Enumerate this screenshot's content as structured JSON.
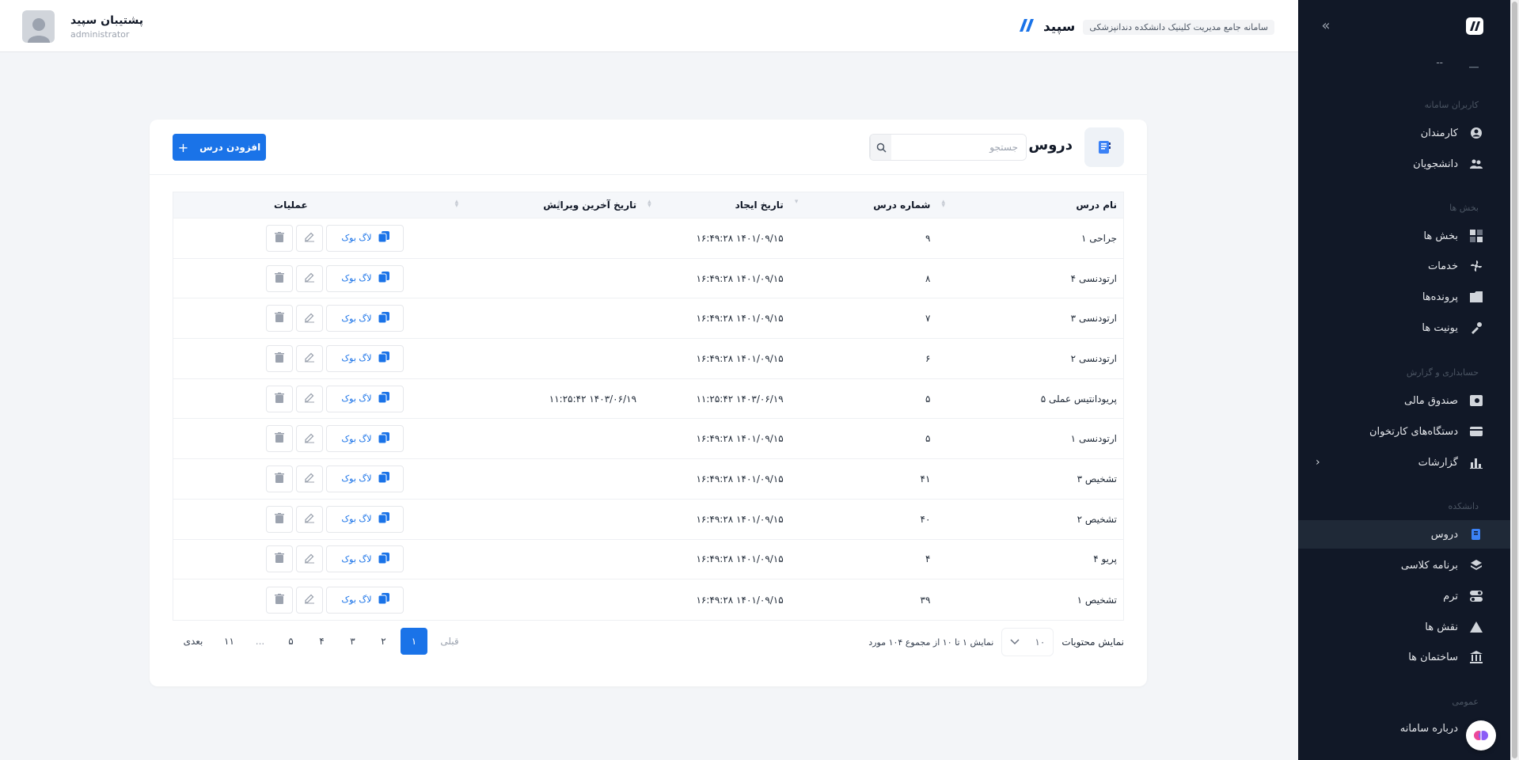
{
  "header": {
    "brand_name": "سپید",
    "brand_tagline": "سامانه جامع مدیریت کلینیک دانشکده دندانپزشکی",
    "user_name": "پشتیبان سپید",
    "user_role": "administrator"
  },
  "sidebar": {
    "user_placeholder": "--",
    "sections": {
      "users": "کاربران سامانه",
      "departments": "بخش ها",
      "accounting": "حسابداری و گزارش",
      "faculty": "دانشکده",
      "general": "عمومی"
    },
    "items": {
      "staff": "کارمندان",
      "students": "دانشجویان",
      "departments": "بخش ها",
      "services": "خدمات",
      "files": "پرونده‌ها",
      "units": "یونیت ها",
      "cashbox": "صندوق مالی",
      "card_readers": "دستگاه‌های کارتخوان",
      "reports": "گزارشات",
      "courses": "دروس",
      "class_schedule": "برنامه کلاسی",
      "term": "ترم",
      "roles": "نقش ها",
      "buildings": "ساختمان ها",
      "about": "درباره سامانه"
    }
  },
  "page": {
    "title": "دروس",
    "search_placeholder": "جستجو",
    "add_button": "افزودن درس"
  },
  "table": {
    "headers": {
      "name": "نام درس",
      "number": "شماره درس",
      "created": "تاریخ ایجاد",
      "updated": "تاریخ آخرین ویرایش",
      "ops": "عملیات"
    },
    "log_label": "لاگ بوک",
    "rows": [
      {
        "name": "جراحی ۱",
        "number": "۹",
        "created": "۱۴۰۱/۰۹/۱۵ ۱۶:۴۹:۲۸",
        "updated": ""
      },
      {
        "name": "ارتودنسی ۴",
        "number": "۸",
        "created": "۱۴۰۱/۰۹/۱۵ ۱۶:۴۹:۲۸",
        "updated": ""
      },
      {
        "name": "ارتودنسی ۳",
        "number": "۷",
        "created": "۱۴۰۱/۰۹/۱۵ ۱۶:۴۹:۲۸",
        "updated": ""
      },
      {
        "name": "ارتودنسی ۲",
        "number": "۶",
        "created": "۱۴۰۱/۰۹/۱۵ ۱۶:۴۹:۲۸",
        "updated": ""
      },
      {
        "name": "پریودانتیس عملی ۵",
        "number": "۵",
        "created": "۱۴۰۳/۰۶/۱۹ ۱۱:۲۵:۴۲",
        "updated": "۱۴۰۳/۰۶/۱۹ ۱۱:۲۵:۴۲"
      },
      {
        "name": "ارتودنسی ۱",
        "number": "۵",
        "created": "۱۴۰۱/۰۹/۱۵ ۱۶:۴۹:۲۸",
        "updated": ""
      },
      {
        "name": "تشخیص ۳",
        "number": "۴۱",
        "created": "۱۴۰۱/۰۹/۱۵ ۱۶:۴۹:۲۸",
        "updated": ""
      },
      {
        "name": "تشخیص ۲",
        "number": "۴۰",
        "created": "۱۴۰۱/۰۹/۱۵ ۱۶:۴۹:۲۸",
        "updated": ""
      },
      {
        "name": "پریو ۴",
        "number": "۴",
        "created": "۱۴۰۱/۰۹/۱۵ ۱۶:۴۹:۲۸",
        "updated": ""
      },
      {
        "name": "تشخیص ۱",
        "number": "۳۹",
        "created": "۱۴۰۱/۰۹/۱۵ ۱۶:۴۹:۲۸",
        "updated": ""
      }
    ]
  },
  "footer": {
    "page_size_label": "نمایش محتویات",
    "page_size_value": "۱۰",
    "summary": "نمایش ۱ تا ۱۰ از مجموع ۱۰۴ مورد",
    "prev": "قبلی",
    "next": "بعدی",
    "pages": [
      "۱",
      "۲",
      "۳",
      "۴",
      "۵",
      "...",
      "۱۱"
    ],
    "active_page": "۱"
  },
  "colors": {
    "primary": "#1a73e8",
    "sidebar_bg": "#111827",
    "page_bg": "#f3f5f8"
  }
}
